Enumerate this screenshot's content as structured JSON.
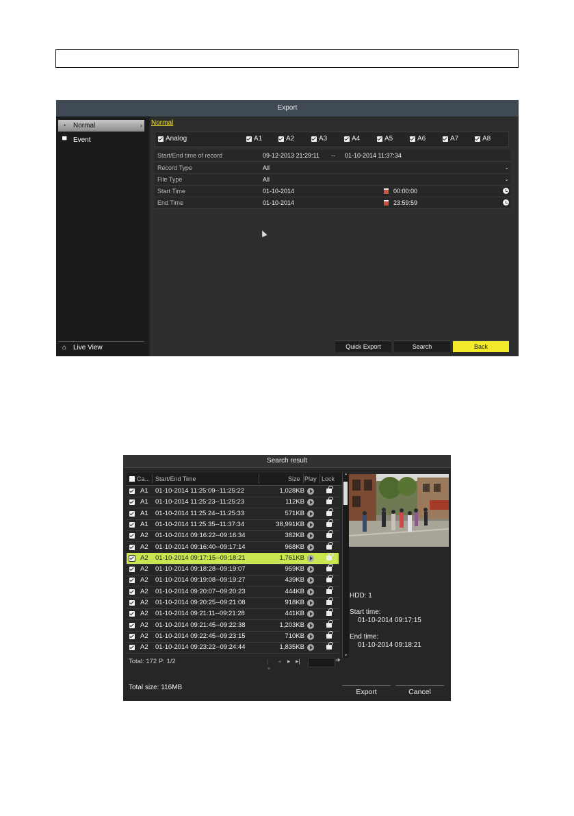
{
  "export": {
    "title": "Export",
    "sidebar": {
      "normal": "Normal",
      "event": "Event",
      "live_view": "Live View"
    },
    "tab": "Normal",
    "analog_label": "Analog",
    "channels": [
      "A1",
      "A2",
      "A3",
      "A4",
      "A5",
      "A6",
      "A7",
      "A8"
    ],
    "fields": {
      "record_range_label": "Start/End time of record",
      "record_start": "09-12-2013 21:29:11",
      "record_sep": "--",
      "record_end": "01-10-2014 11:37:34",
      "record_type_label": "Record Type",
      "record_type_value": "All",
      "file_type_label": "File Type",
      "file_type_value": "All",
      "start_time_label": "Start Time",
      "start_date": "01-10-2014",
      "start_clock": "00:00:00",
      "end_time_label": "End Time",
      "end_date": "01-10-2014",
      "end_clock": "23:59:59"
    },
    "buttons": {
      "quick_export": "Quick Export",
      "search": "Search",
      "back": "Back"
    }
  },
  "search_result": {
    "title": "Search result",
    "columns": {
      "channel": "Ca...",
      "time": "Start/End Time",
      "size": "Size",
      "play": "Play",
      "lock": "Lock"
    },
    "rows": [
      {
        "ch": "A1",
        "time": "01-10-2014 11:25:09--11:25:22",
        "size": "1,028KB"
      },
      {
        "ch": "A1",
        "time": "01-10-2014 11:25:23--11:25:23",
        "size": "112KB"
      },
      {
        "ch": "A1",
        "time": "01-10-2014 11:25:24--11:25:33",
        "size": "571KB"
      },
      {
        "ch": "A1",
        "time": "01-10-2014 11:25:35--11:37:34",
        "size": "38,991KB"
      },
      {
        "ch": "A2",
        "time": "01-10-2014 09:16:22--09:16:34",
        "size": "382KB"
      },
      {
        "ch": "A2",
        "time": "01-10-2014 09:16:40--09:17:14",
        "size": "968KB"
      },
      {
        "ch": "A2",
        "time": "01-10-2014 09:17:15--09:18:21",
        "size": "1,761KB"
      },
      {
        "ch": "A2",
        "time": "01-10-2014 09:18:28--09:19:07",
        "size": "959KB"
      },
      {
        "ch": "A2",
        "time": "01-10-2014 09:19:08--09:19:27",
        "size": "439KB"
      },
      {
        "ch": "A2",
        "time": "01-10-2014 09:20:07--09:20:23",
        "size": "444KB"
      },
      {
        "ch": "A2",
        "time": "01-10-2014 09:20:25--09:21:08",
        "size": "918KB"
      },
      {
        "ch": "A2",
        "time": "01-10-2014 09:21:11--09:21:28",
        "size": "441KB"
      },
      {
        "ch": "A2",
        "time": "01-10-2014 09:21:45--09:22:38",
        "size": "1,203KB"
      },
      {
        "ch": "A2",
        "time": "01-10-2014 09:22:45--09:23:15",
        "size": "710KB"
      },
      {
        "ch": "A2",
        "time": "01-10-2014 09:23:22--09:24:44",
        "size": "1,835KB"
      }
    ],
    "selected_index": 6,
    "total": "Total: 172  P: 1/2",
    "info": {
      "hdd": "HDD: 1",
      "start_label": "Start time:",
      "start_value": "01-10-2014 09:17:15",
      "end_label": "End time:",
      "end_value": "01-10-2014 09:18:21"
    },
    "total_size": "Total size: 116MB",
    "buttons": {
      "export": "Export",
      "cancel": "Cancel"
    }
  }
}
